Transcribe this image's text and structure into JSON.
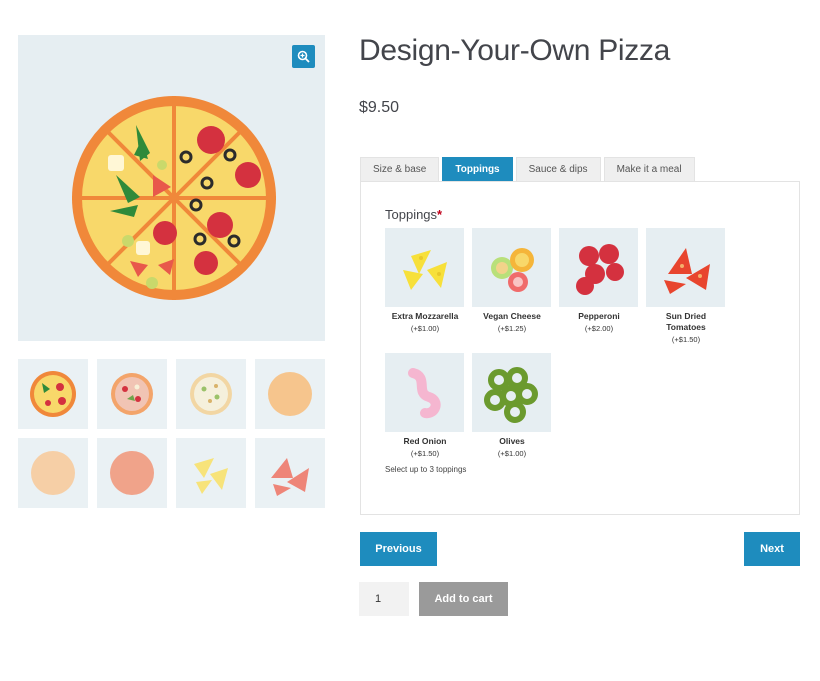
{
  "product": {
    "title": "Design-Your-Own Pizza",
    "price": "$9.50"
  },
  "gallery": {
    "main_image": "pizza-full-icon",
    "zoom_icon": "magnify-plus-icon",
    "thumbnails": [
      "pizza-full-icon",
      "pizza-meat-icon",
      "pizza-white-icon",
      "pizza-base-icon",
      "dough-light-icon",
      "dough-red-icon",
      "cheese-triangles-icon",
      "tomato-slices-icon"
    ]
  },
  "tabs": [
    {
      "label": "Size & base",
      "active": false
    },
    {
      "label": "Toppings",
      "active": true
    },
    {
      "label": "Sauce & dips",
      "active": false
    },
    {
      "label": "Make it a meal",
      "active": false
    }
  ],
  "toppings": {
    "label": "Toppings",
    "required_mark": "*",
    "options": [
      {
        "name": "Extra Mozzarella",
        "price": "(+$1.00)",
        "icon": "cheese-triangles-icon"
      },
      {
        "name": "Vegan Cheese",
        "price": "(+$1.25)",
        "icon": "vegan-cheese-icon"
      },
      {
        "name": "Pepperoni",
        "price": "(+$2.00)",
        "icon": "pepperoni-icon"
      },
      {
        "name": "Sun Dried Tomatoes",
        "price": "(+$1.50)",
        "icon": "tomato-slices-icon"
      },
      {
        "name": "Red Onion",
        "price": "(+$1.50)",
        "icon": "red-onion-icon"
      },
      {
        "name": "Olives",
        "price": "(+$1.00)",
        "icon": "olives-icon"
      }
    ],
    "hint": "Select up to 3 toppings"
  },
  "nav": {
    "previous": "Previous",
    "next": "Next"
  },
  "cart": {
    "quantity": "1",
    "add_label": "Add to cart"
  },
  "colors": {
    "accent": "#1e8cbe",
    "disabled": "#9a9a9a",
    "panel_bg": "#e6eef2"
  }
}
